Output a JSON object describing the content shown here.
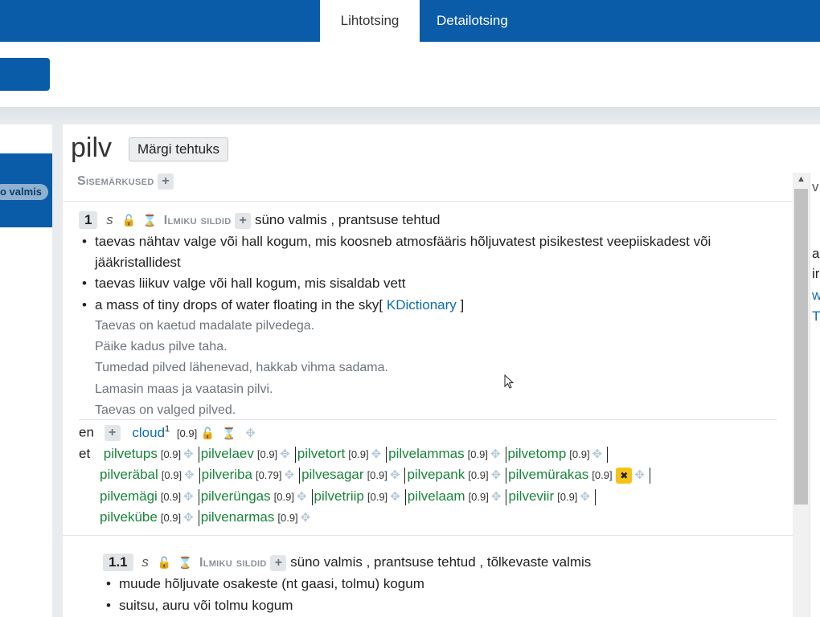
{
  "nav": {
    "tabs": [
      {
        "label": "Lihtotsing"
      },
      {
        "label": "Detailotsing"
      }
    ]
  },
  "left": {
    "badge": "o valmis"
  },
  "word": {
    "title": "pilv",
    "mark_done": "Märgi tehtuks",
    "internal_notes_label": "Sisemärkused"
  },
  "meaning1": {
    "number": "1",
    "register": "s",
    "tags_label": "Ilmiku sildid",
    "tags": "süno valmis , prantsuse tehtud",
    "definitions": [
      "taevas nähtav valge või hall kogum, mis koosneb atmosfääris hõljuvatest pisikestest veepiiskadest või jääkristallidest",
      "taevas liikuv valge või hall kogum, mis sisaldab vett",
      "a mass of tiny drops of water floating in the sky"
    ],
    "source_prefix": "[",
    "source": "KDictionary",
    "source_suffix": "]",
    "examples": [
      "Taevas on kaetud madalate pilvedega.",
      "Päike kadus pilve taha.",
      "Tumedad pilved lähenevad, hakkab vihma sadama.",
      "Lamasin maas ja vaatasin pilvi.",
      "Taevas on valged pilved."
    ],
    "translations": {
      "en_label": "en",
      "en_word": "cloud",
      "en_sup": "1",
      "en_weight": "[0.9]",
      "et_label": "et",
      "et_words": [
        {
          "w": "pilvetups",
          "v": "[0.9]"
        },
        {
          "w": "pilvelaev",
          "v": "[0.9]"
        },
        {
          "w": "pilvetort",
          "v": "[0.9]"
        },
        {
          "w": "pilvelammas",
          "v": "[0.9]"
        },
        {
          "w": "pilvetomp",
          "v": "[0.9]"
        },
        {
          "w": "pilveräbal",
          "v": "[0.9]"
        },
        {
          "w": "pilveriba",
          "v": "[0.79]"
        },
        {
          "w": "pilvesagar",
          "v": "[0.9]"
        },
        {
          "w": "pilvepank",
          "v": "[0.9]"
        },
        {
          "w": "pilvemürakas",
          "v": "[0.9]"
        },
        {
          "w": "pilvemägi",
          "v": "[0.9]"
        },
        {
          "w": "pilverüngas",
          "v": "[0.9]"
        },
        {
          "w": "pilvetriip",
          "v": "[0.9]"
        },
        {
          "w": "pilvelaam",
          "v": "[0.9]"
        },
        {
          "w": "pilveviir",
          "v": "[0.9]"
        },
        {
          "w": "pilvekübe",
          "v": "[0.9]"
        },
        {
          "w": "pilvenarmas",
          "v": "[0.9]"
        }
      ]
    }
  },
  "meaning11": {
    "number": "1.1",
    "register": "s",
    "tags_label": "Ilmiku sildid",
    "tags": "süno valmis , prantsuse tehtud , tõlkevaste valmis",
    "definitions": [
      "muude hõljuvate osakeste (nt gaasi, tolmu) kogum",
      "suitsu, auru või tolmu kogum"
    ]
  },
  "right_fragments": [
    "v",
    "a",
    "ir",
    "w",
    "T"
  ],
  "colors": {
    "primary": "#0a5ba8",
    "link": "#0a6cb8",
    "word_link": "#18853a",
    "delete": "#f5c219"
  }
}
